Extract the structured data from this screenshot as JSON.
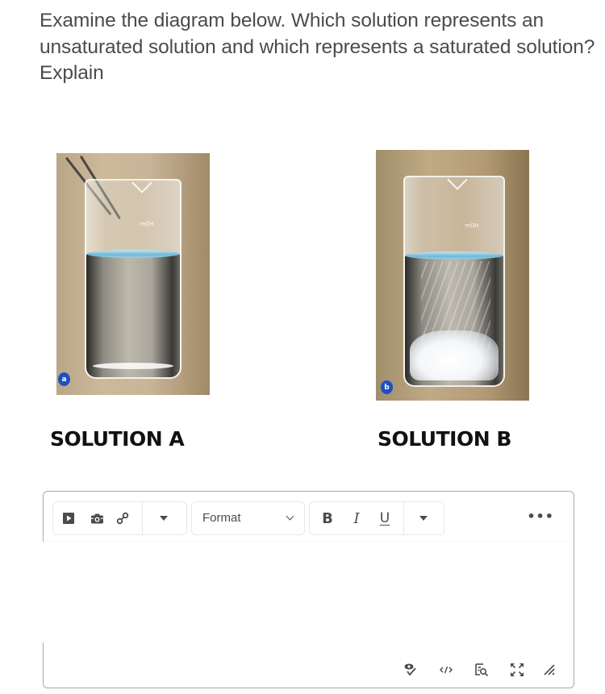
{
  "question": {
    "text": "Examine the diagram below. Which  solution represents an unsaturated solution and which represents a saturated solution? Explain"
  },
  "figures": [
    {
      "id": "a",
      "badge": "a",
      "caption": "SOLUTION A",
      "description": "Beaker of clear solution with tongs, no crystals"
    },
    {
      "id": "b",
      "badge": "b",
      "caption": "SOLUTION B",
      "description": "Beaker with crystals precipitated at bottom"
    }
  ],
  "beaker_marking": "mOH",
  "editor": {
    "toolbar": {
      "insert_group": [
        {
          "icon": "video-icon",
          "label": "Insert Stuff"
        },
        {
          "icon": "camera-icon",
          "label": "Insert Image"
        },
        {
          "icon": "link-icon",
          "label": "Insert Link"
        },
        {
          "icon": "caret-down-icon",
          "label": "More insert options"
        }
      ],
      "format_select": {
        "label": "Format"
      },
      "style_group": [
        {
          "icon": "bold-icon",
          "label": "B"
        },
        {
          "icon": "italic-icon",
          "label": "I"
        },
        {
          "icon": "underline-icon",
          "label": "U"
        },
        {
          "icon": "caret-down-icon",
          "label": "More formatting"
        }
      ],
      "more_label": "•••"
    },
    "content": "",
    "status_bar": [
      {
        "icon": "accessibility-check-icon",
        "label": "Accessibility Checker"
      },
      {
        "icon": "source-code-icon",
        "label": "Source Code"
      },
      {
        "icon": "preview-icon",
        "label": "Preview"
      },
      {
        "icon": "fullscreen-icon",
        "label": "Fullscreen"
      },
      {
        "icon": "resize-handle-icon",
        "label": "Resize"
      }
    ]
  },
  "colors": {
    "text": "#494c4e",
    "caption": "#111111",
    "badge": "#1f4fc4",
    "border": "#a9a9a9",
    "toolbar_border": "#e3e9f1"
  }
}
